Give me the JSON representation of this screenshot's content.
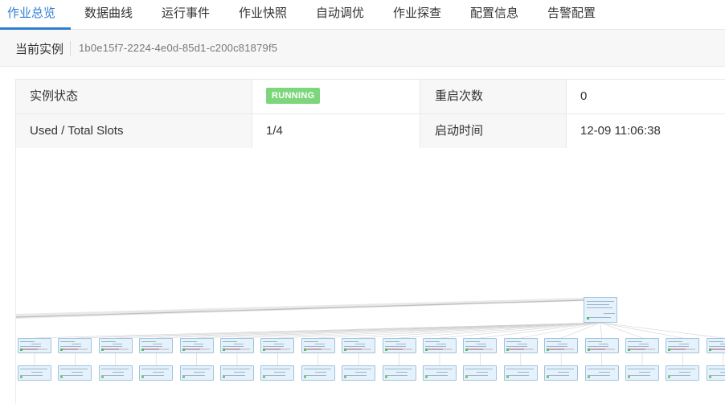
{
  "tabs": [
    {
      "label": "作业总览",
      "active": true
    },
    {
      "label": "数据曲线",
      "active": false
    },
    {
      "label": "运行事件",
      "active": false
    },
    {
      "label": "作业快照",
      "active": false
    },
    {
      "label": "自动调优",
      "active": false
    },
    {
      "label": "作业探查",
      "active": false
    },
    {
      "label": "配置信息",
      "active": false
    },
    {
      "label": "告警配置",
      "active": false
    }
  ],
  "instance": {
    "label": "当前实例",
    "id": "1b0e15f7-2224-4e0d-85d1-c200c81879f5"
  },
  "info": {
    "status_label": "实例状态",
    "status_value": "RUNNING",
    "restart_label": "重启次数",
    "restart_value": "0",
    "slots_label": "Used / Total Slots",
    "slots_value": "1/4",
    "start_label": "启动时间",
    "start_value": "12-09 11:06:38"
  },
  "colors": {
    "accent": "#2f7fd0",
    "running_badge": "#7ed67c",
    "node_fill": "#e6f2fb",
    "node_border": "#9fc3e0"
  }
}
